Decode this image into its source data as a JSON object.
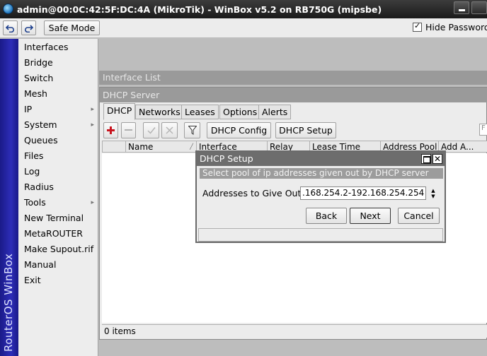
{
  "window": {
    "title": "admin@00:0C:42:5F:DC:4A (MikroTik) - WinBox v5.2 on RB750G (mipsbe)"
  },
  "toolbar": {
    "undo_icon": "undo-icon",
    "redo_icon": "redo-icon",
    "safe_mode_label": "Safe Mode",
    "hide_passwords_label": "Hide Passwords",
    "hide_passwords_checked": true
  },
  "brand": {
    "vertical_text": "RouterOS WinBox"
  },
  "menu": {
    "items": [
      {
        "label": "Interfaces",
        "submenu": false
      },
      {
        "label": "Bridge",
        "submenu": false
      },
      {
        "label": "Switch",
        "submenu": false
      },
      {
        "label": "Mesh",
        "submenu": false
      },
      {
        "label": "IP",
        "submenu": true
      },
      {
        "label": "System",
        "submenu": true
      },
      {
        "label": "Queues",
        "submenu": false
      },
      {
        "label": "Files",
        "submenu": false
      },
      {
        "label": "Log",
        "submenu": false
      },
      {
        "label": "Radius",
        "submenu": false
      },
      {
        "label": "Tools",
        "submenu": true
      },
      {
        "label": "New Terminal",
        "submenu": false
      },
      {
        "label": "MetaROUTER",
        "submenu": false
      },
      {
        "label": "Make Supout.rif",
        "submenu": false
      },
      {
        "label": "Manual",
        "submenu": false
      },
      {
        "label": "Exit",
        "submenu": false
      }
    ],
    "submenu_arrow": "▸"
  },
  "interface_list": {
    "title": "Interface List"
  },
  "dhcp_server": {
    "title": "DHCP Server",
    "tabs": [
      "DHCP",
      "Networks",
      "Leases",
      "Options",
      "Alerts"
    ],
    "active_tab": "DHCP",
    "toolbar": {
      "add_icon": "plus-icon",
      "remove_icon": "minus-icon",
      "enable_icon": "check-icon",
      "disable_icon": "cross-icon",
      "filter_icon": "filter-icon",
      "dhcp_config_label": "DHCP Config",
      "dhcp_setup_label": "DHCP Setup",
      "find_placeholder": "F"
    },
    "columns": [
      "Name",
      "Interface",
      "Relay",
      "Lease Time",
      "Address Pool",
      "Add A..."
    ],
    "status": "0 items"
  },
  "dhcp_setup_dialog": {
    "title": "DHCP Setup",
    "description": "Select pool of ip addresses given out by DHCP server",
    "field_label": "Addresses to Give Out:",
    "field_value": ".168.254.2-192.168.254.254",
    "back_label": "Back",
    "next_label": "Next",
    "cancel_label": "Cancel",
    "close_glyph": "✕"
  }
}
